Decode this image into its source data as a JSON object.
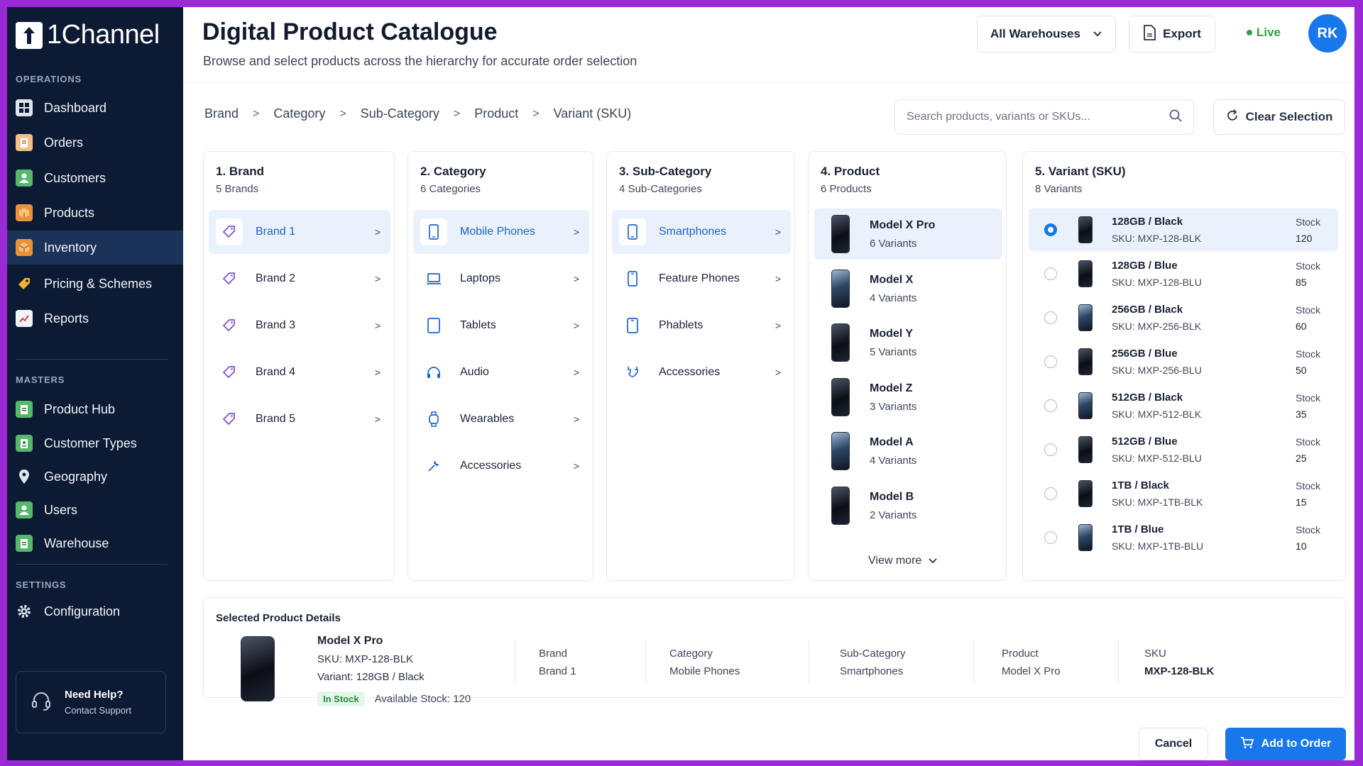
{
  "app": {
    "name": "1Channel"
  },
  "sidebar": {
    "sections": {
      "operations": "OPERATIONS",
      "masters": "MASTERS",
      "settings": "SETTINGS"
    },
    "items": [
      {
        "label": "Dashboard",
        "icon": "dashboard-icon",
        "active": false
      },
      {
        "label": "Orders",
        "icon": "orders-icon",
        "active": false
      },
      {
        "label": "Customers",
        "icon": "customers-icon",
        "active": false
      },
      {
        "label": "Products",
        "icon": "products-icon",
        "active": false
      },
      {
        "label": "Inventory",
        "icon": "inventory-icon",
        "active": true
      },
      {
        "label": "Pricing & Schemes",
        "icon": "pricing-icon",
        "active": false
      },
      {
        "label": "Reports",
        "icon": "reports-icon",
        "active": false
      },
      {
        "label": "Product Hub",
        "icon": "product-hub-icon",
        "active": false
      },
      {
        "label": "Customer Types",
        "icon": "customer-types-icon",
        "active": false
      },
      {
        "label": "Geography",
        "icon": "map-pin-icon",
        "active": false
      },
      {
        "label": "Users",
        "icon": "users-icon",
        "active": false
      },
      {
        "label": "Warehouse",
        "icon": "warehouse-icon",
        "active": false
      },
      {
        "label": "Configuration",
        "icon": "gear-icon",
        "active": false
      }
    ],
    "help": {
      "title": "Need Help?",
      "subtitle": "Contact Support"
    }
  },
  "header": {
    "title": "Digital Product Catalogue",
    "subtitle": "Browse and select products across the hierarchy for accurate order selection",
    "warehouse_select": "All Warehouses",
    "export_label": "Export",
    "status": "Live",
    "avatar": "RK"
  },
  "breadcrumb": [
    "Brand",
    "Category",
    "Sub-Category",
    "Product",
    "Variant (SKU)"
  ],
  "search": {
    "placeholder": "Search products, variants or SKUs..."
  },
  "clear_label": "Clear Selection",
  "columns": {
    "brand": {
      "title": "1. Brand",
      "subtitle": "5 Brands",
      "items": [
        "Brand 1",
        "Brand 2",
        "Brand 3",
        "Brand 4",
        "Brand 5"
      ],
      "selected": 0
    },
    "category": {
      "title": "2. Category",
      "subtitle": "6 Categories",
      "items": [
        "Mobile Phones",
        "Laptops",
        "Tablets",
        "Audio",
        "Wearables",
        "Accessories"
      ],
      "selected": 0
    },
    "subcategory": {
      "title": "3. Sub-Category",
      "subtitle": "4 Sub-Categories",
      "items": [
        "Smartphones",
        "Feature Phones",
        "Phablets",
        "Accessories"
      ],
      "selected": 0
    },
    "product": {
      "title": "4. Product",
      "subtitle": "6 Products",
      "items": [
        {
          "name": "Model X Pro",
          "variants": "6 Variants"
        },
        {
          "name": "Model X",
          "variants": "4 Variants"
        },
        {
          "name": "Model Y",
          "variants": "5 Variants"
        },
        {
          "name": "Model Z",
          "variants": "3 Variants"
        },
        {
          "name": "Model A",
          "variants": "4 Variants"
        },
        {
          "name": "Model B",
          "variants": "2 Variants"
        }
      ],
      "selected": 0,
      "view_more": "View more"
    },
    "variant": {
      "title": "5. Variant (SKU)",
      "subtitle": "8 Variants",
      "stock_label": "Stock",
      "items": [
        {
          "name": "128GB / Black",
          "sku": "SKU: MXP-128-BLK",
          "stock": "120",
          "color": "black"
        },
        {
          "name": "128GB / Blue",
          "sku": "SKU: MXP-128-BLU",
          "stock": "85",
          "color": "black"
        },
        {
          "name": "256GB / Black",
          "sku": "SKU: MXP-256-BLK",
          "stock": "60",
          "color": "blue"
        },
        {
          "name": "256GB / Blue",
          "sku": "SKU: MXP-256-BLU",
          "stock": "50",
          "color": "black"
        },
        {
          "name": "512GB / Black",
          "sku": "SKU: MXP-512-BLK",
          "stock": "35",
          "color": "blue"
        },
        {
          "name": "512GB / Blue",
          "sku": "SKU: MXP-512-BLU",
          "stock": "25",
          "color": "black"
        },
        {
          "name": "1TB / Black",
          "sku": "SKU: MXP-1TB-BLK",
          "stock": "15",
          "color": "black"
        },
        {
          "name": "1TB / Blue",
          "sku": "SKU: MXP-1TB-BLU",
          "stock": "10",
          "color": "blue"
        }
      ],
      "selected": 0
    }
  },
  "details": {
    "title": "Selected Product Details",
    "name": "Model X Pro",
    "sku": "SKU: MXP-128-BLK",
    "variant": "Variant: 128GB / Black",
    "badge": "In Stock",
    "available": "Available Stock: 120",
    "fields": [
      {
        "key": "Brand",
        "value": "Brand 1"
      },
      {
        "key": "Category",
        "value": "Mobile Phones"
      },
      {
        "key": "Sub-Category",
        "value": "Smartphones"
      },
      {
        "key": "Product",
        "value": "Model X Pro"
      },
      {
        "key": "SKU",
        "value": "MXP-128-BLK"
      }
    ]
  },
  "actions": {
    "cancel": "Cancel",
    "add": "Add to Order"
  },
  "colors": {
    "accent": "#1877ea",
    "sidebar": "#0c1a34",
    "live": "#2ca24a",
    "frame": "#9a2ad6"
  }
}
